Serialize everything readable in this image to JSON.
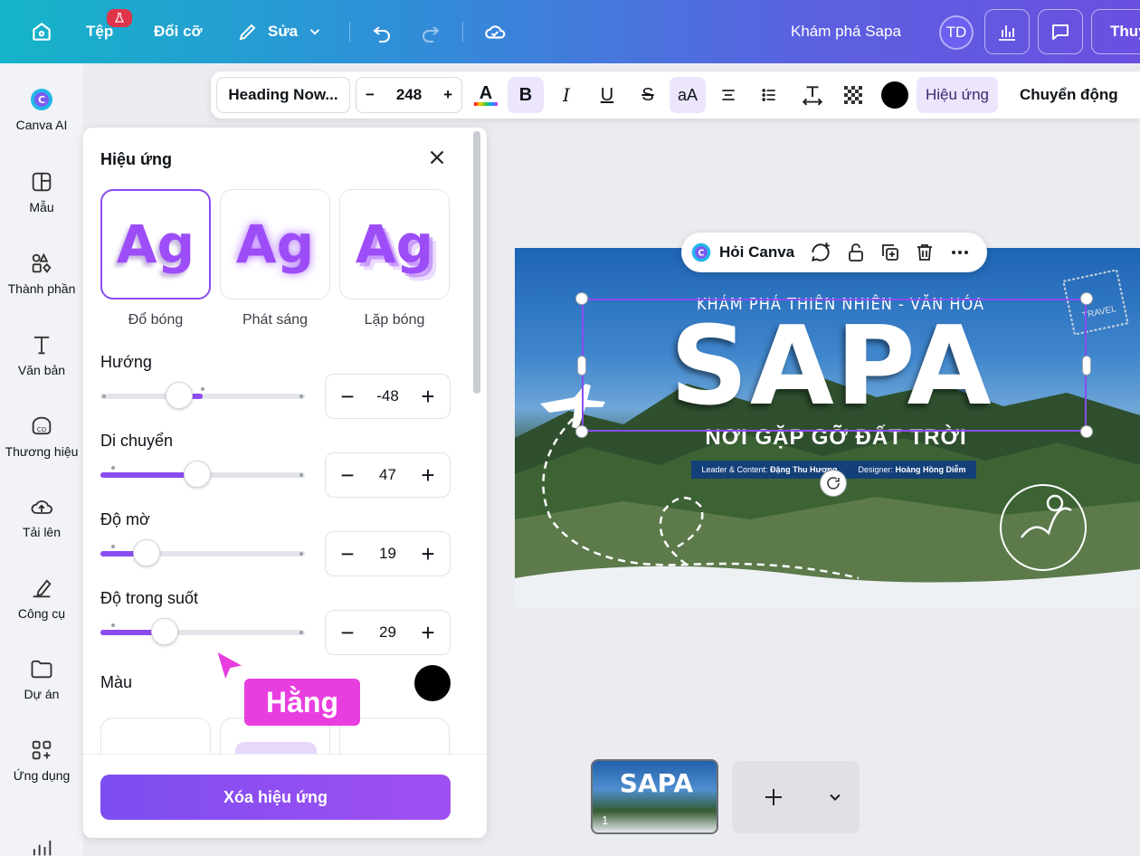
{
  "topbar": {
    "file_label": "Tệp",
    "resize_label": "Đổi cỡ",
    "edit_label": "Sửa",
    "design_title": "Khám phá Sapa",
    "avatar_initials": "TD",
    "share_label": "Thuy"
  },
  "rail": {
    "items": [
      {
        "label": "Canva AI"
      },
      {
        "label": "Mẫu"
      },
      {
        "label": "Thành phần"
      },
      {
        "label": "Văn bản"
      },
      {
        "label": "Thương hiệu"
      },
      {
        "label": "Tải lên"
      },
      {
        "label": "Công cụ"
      },
      {
        "label": "Dự án"
      },
      {
        "label": "Ứng dụng"
      }
    ]
  },
  "toolbar": {
    "font_name": "Heading Now...",
    "font_size": "248",
    "effects_label": "Hiệu ứng",
    "animate_label": "Chuyển động",
    "case_label": "aA",
    "bold_label": "B",
    "italic_label": "I",
    "underline_label": "U",
    "strike_label": "S"
  },
  "panel": {
    "title": "Hiệu ứng",
    "effects": [
      {
        "label": "Đổ bóng",
        "sample": "Ag",
        "selected": true
      },
      {
        "label": "Phát sáng",
        "sample": "Ag",
        "selected": false
      },
      {
        "label": "Lặp bóng",
        "sample": "Ag",
        "selected": false
      }
    ],
    "sliders": [
      {
        "label": "Hướng",
        "value": "-48",
        "fraction": 0.38
      },
      {
        "label": "Di chuyển",
        "value": "47",
        "fraction": 0.47
      },
      {
        "label": "Độ mờ",
        "value": "19",
        "fraction": 0.19
      },
      {
        "label": "Độ trong suốt",
        "value": "29",
        "fraction": 0.29
      }
    ],
    "color_label": "Màu",
    "color_value": "#000000",
    "remove_button": "Xóa hiệu ứng"
  },
  "cursor": {
    "name": "Hằng"
  },
  "context_menu": {
    "ask_label": "Hỏi Canva"
  },
  "design": {
    "subtitle_top": "KHÁM PHÁ THIÊN NHIÊN - VĂN HÓA",
    "headline": "SAPA",
    "tagline": "NƠI GẶP GỠ ĐẤT TRỜI",
    "credit_role_1": "Leader & Content:",
    "credit_name_1": "Đặng Thu Hương",
    "credit_role_2": "Designer:",
    "credit_name_2": "Hoàng Hồng Diễm",
    "stamp_text": "TRAVEL"
  },
  "pages": {
    "thumb_number": "1",
    "thumb_headline": "SAPA"
  },
  "colors": {
    "accent": "#8a4cf0",
    "cursor": "#e83ee0"
  }
}
